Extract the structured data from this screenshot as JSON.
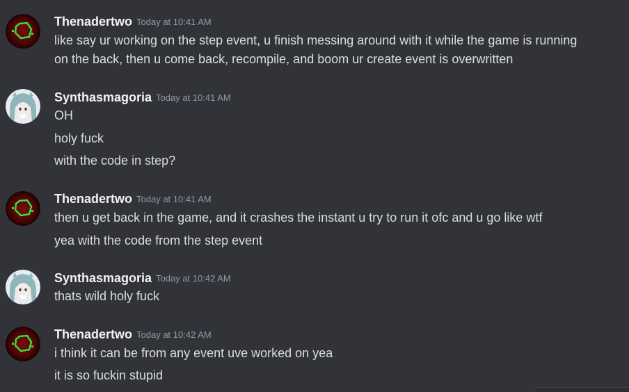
{
  "colors": {
    "background": "#313338",
    "username": "#f2f3f5",
    "timestamp": "#949ba4",
    "message_text": "#dbdee1"
  },
  "messages": [
    {
      "author": "Thenadertwo",
      "avatar_icon": "green-hexagon-avatar-icon",
      "timestamp": "Today at 10:41 AM",
      "lines": [
        "like say ur working on the step event, u finish messing around with it while the game is running",
        "on the back, then u come back, recompile, and boom ur create event is overwritten"
      ]
    },
    {
      "author": "Synthasmagoria",
      "avatar_icon": "anime-girl-avatar-icon",
      "timestamp": "Today at 10:41 AM",
      "lines": [
        "OH",
        "holy fuck",
        "with the code in step?"
      ]
    },
    {
      "author": "Thenadertwo",
      "avatar_icon": "green-hexagon-avatar-icon",
      "timestamp": "Today at 10:41 AM",
      "lines": [
        "then u get back in the game, and it crashes the instant u try to run it ofc and u go like wtf",
        "yea with the code from the step event"
      ]
    },
    {
      "author": "Synthasmagoria",
      "avatar_icon": "anime-girl-avatar-icon",
      "timestamp": "Today at 10:42 AM",
      "lines": [
        "thats wild holy fuck"
      ]
    },
    {
      "author": "Thenadertwo",
      "avatar_icon": "green-hexagon-avatar-icon",
      "timestamp": "Today at 10:42 AM",
      "lines": [
        "i think it can be from any event uve worked on yea",
        "it is so fuckin stupid"
      ]
    }
  ]
}
